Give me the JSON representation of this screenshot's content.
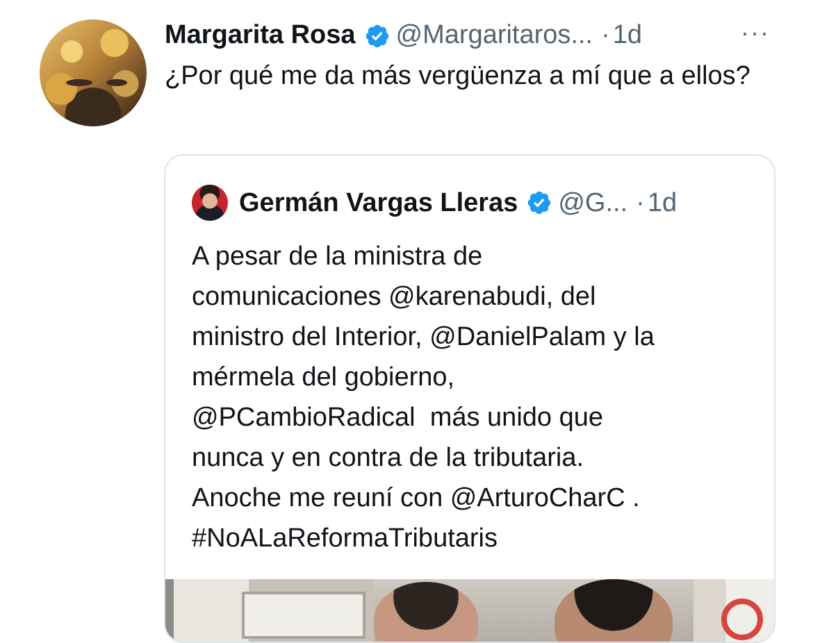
{
  "tweet": {
    "author": {
      "name": "Margarita Rosa",
      "handle": "@Margaritaros...",
      "separator": "·",
      "time": "1d",
      "verified": true
    },
    "more_icon": "more-horizontal-icon",
    "more_label": "···",
    "text": "¿Por qué me da más vergüenza a mí que a ellos?"
  },
  "quote": {
    "author": {
      "name": "Germán Vargas Lleras",
      "handle": "@G...",
      "separator": "·",
      "time": "1d",
      "verified": true
    },
    "text_lines": [
      "A pesar de la ministra de",
      "comunicaciones @karenabudi, del",
      "ministro del Interior, @DanielPalam y la",
      "mérmela del gobierno,",
      "@PCambioRadical  más unido que",
      "nunca y en contra de la tributaria.",
      "Anoche me reuní con @ArturoCharC .",
      "#NoALaReformaTributaris"
    ]
  },
  "colors": {
    "verified_blue": "#1d9bf0",
    "secondary_text": "#536471",
    "primary_text": "#0f1419",
    "border": "#dfe3e6"
  }
}
